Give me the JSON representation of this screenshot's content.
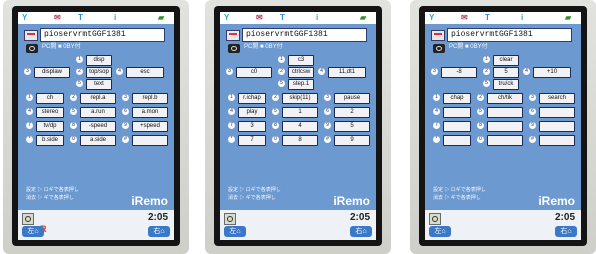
{
  "screenshots": [
    {
      "url": "pioservrmtGGF1381",
      "subtitle": "PC開 ■ 0BY付",
      "buttons": [
        {
          "n": "1",
          "label": "disp"
        },
        {
          "n": "3",
          "label": "displaw"
        },
        {
          "n": "2",
          "label": "top/sop"
        },
        {
          "n": "4",
          "label": "esc"
        },
        {
          "n": "5",
          "label": "text"
        },
        {
          "n": "1",
          "label": "ch"
        },
        {
          "n": "2",
          "label": "repl.a"
        },
        {
          "n": "3",
          "label": "repl.b"
        },
        {
          "n": "4",
          "label": "stereo"
        },
        {
          "n": "5",
          "label": "a.run"
        },
        {
          "n": "6",
          "label": "a.mon"
        },
        {
          "n": "7",
          "label": "tv/dp"
        },
        {
          "n": "8",
          "label": "-speed"
        },
        {
          "n": "9",
          "label": "+speed"
        },
        {
          "n": "*",
          "label": "b.side"
        },
        {
          "n": "0",
          "label": "a.side"
        },
        {
          "n": "#",
          "label": ""
        }
      ],
      "footer_line1": "設定 ▷ ロギで各表押し",
      "footer_line2": "消去 ▷ ギで各表押し",
      "logo": "iRemo",
      "clock": "2:05",
      "softkey_left": "左⌂",
      "softkey_right": "右⌂"
    },
    {
      "url": "pioservrmtGGF1381",
      "subtitle": "PC開 ■ 0BY付",
      "buttons": [
        {
          "n": "1",
          "label": "c3"
        },
        {
          "n": "3",
          "label": "c0"
        },
        {
          "n": "2",
          "label": "ctrlcsw"
        },
        {
          "n": "4",
          "label": "11,dt1"
        },
        {
          "n": "5",
          "label": "step.1"
        },
        {
          "n": "1",
          "label": "r.ichap"
        },
        {
          "n": "2",
          "label": "skip(11)"
        },
        {
          "n": "3",
          "label": "pause"
        },
        {
          "n": "4",
          "label": "play"
        },
        {
          "n": "5",
          "label": "1"
        },
        {
          "n": "6",
          "label": "2"
        },
        {
          "n": "7",
          "label": "3"
        },
        {
          "n": "8",
          "label": "4"
        },
        {
          "n": "9",
          "label": "5"
        },
        {
          "n": "*",
          "label": "7"
        },
        {
          "n": "0",
          "label": "8"
        },
        {
          "n": "#",
          "label": "9"
        }
      ],
      "footer_line1": "設定 ▷ ロギで各表押し",
      "footer_line2": "消去 ▷ ギで各表押し",
      "logo": "iRemo",
      "clock": "2:05",
      "softkey_left": "左⌂",
      "softkey_right": "右⌂"
    },
    {
      "url": "pioservrmtGGF1381",
      "subtitle": "PC開 ■ 0BY付",
      "buttons": [
        {
          "n": "1",
          "label": "clear"
        },
        {
          "n": "3",
          "label": "-8"
        },
        {
          "n": "2",
          "label": "5"
        },
        {
          "n": "4",
          "label": "+10"
        },
        {
          "n": "5",
          "label": "tru/ck"
        },
        {
          "n": "1",
          "label": "chap"
        },
        {
          "n": "2",
          "label": "ch/tik"
        },
        {
          "n": "3",
          "label": "search"
        },
        {
          "n": "4",
          "label": ""
        },
        {
          "n": "5",
          "label": ""
        },
        {
          "n": "6",
          "label": ""
        },
        {
          "n": "7",
          "label": ""
        },
        {
          "n": "8",
          "label": ""
        },
        {
          "n": "9",
          "label": ""
        },
        {
          "n": "*",
          "label": ""
        },
        {
          "n": "0",
          "label": ""
        },
        {
          "n": "#",
          "label": ""
        }
      ],
      "footer_line1": "設定 ▷ ロギで各表押し",
      "footer_line2": "消去 ▷ ギで各表押し",
      "logo": "iRemo",
      "clock": "2:05",
      "softkey_left": "左⌂",
      "softkey_right": "右⌂"
    }
  ],
  "status_icons": [
    "antenna-icon",
    "mail-icon",
    "signal-icon",
    "info-icon",
    "battery-icon"
  ],
  "colors": {
    "screen_bg": "#6c9ad0",
    "button_bg": "#f2f2f6",
    "button_border": "#1c2b55",
    "softkey": "#3b78c8",
    "bezel": "#141414"
  }
}
